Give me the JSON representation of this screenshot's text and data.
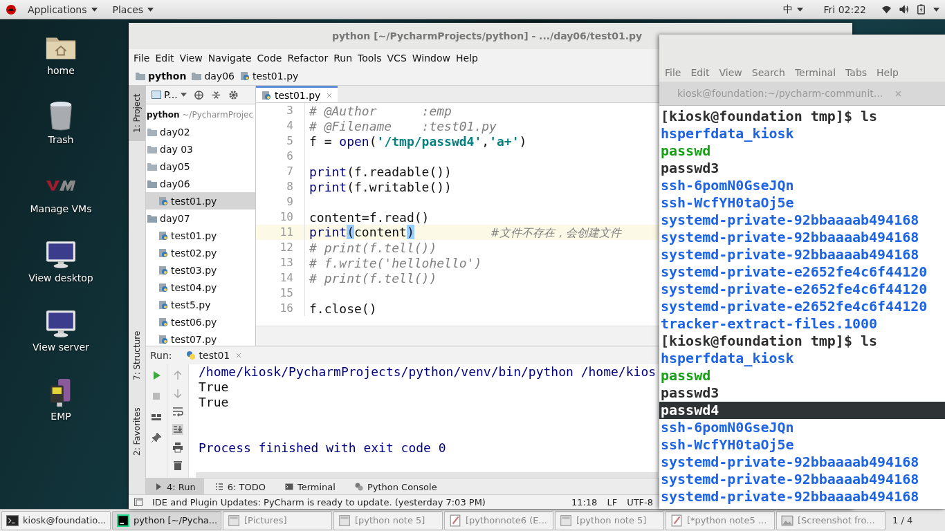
{
  "top_bar": {
    "applications": "Applications",
    "places": "Places",
    "input_method": "中",
    "clock": "Fri 02:22"
  },
  "desktop_icons": [
    {
      "label": "home",
      "kind": "home"
    },
    {
      "label": "Trash",
      "kind": "trash"
    },
    {
      "label": "Manage VMs",
      "kind": "vm"
    },
    {
      "label": "View desktop",
      "kind": "monitor"
    },
    {
      "label": "View server",
      "kind": "monitor"
    },
    {
      "label": "EMP",
      "kind": "emp"
    }
  ],
  "ide": {
    "title": "python [~/PycharmProjects/python] - .../day06/test01.py",
    "menu": [
      "File",
      "Edit",
      "View",
      "Navigate",
      "Code",
      "Refactor",
      "Run",
      "Tools",
      "VCS",
      "Window",
      "Help"
    ],
    "breadcrumb": [
      {
        "label": "python",
        "kind": "project"
      },
      {
        "label": "day06",
        "kind": "folder"
      },
      {
        "label": "test01.py",
        "kind": "file"
      }
    ],
    "side_tabs": [
      {
        "label": "1: Project",
        "selected": true
      },
      {
        "label": "7: Structure",
        "selected": false
      },
      {
        "label": "2: Favorites",
        "selected": false
      }
    ],
    "project_view": "P...",
    "tree_root": {
      "name": "python",
      "path": "~/PycharmProjec"
    },
    "tree": [
      {
        "name": "day02",
        "expanded": false,
        "selected": false
      },
      {
        "name": "day 03",
        "expanded": false,
        "selected": false
      },
      {
        "name": "day05",
        "expanded": false,
        "selected": false
      },
      {
        "name": "day06",
        "expanded": true,
        "selected": false,
        "children": [
          {
            "name": "test01.py",
            "selected": true
          }
        ]
      },
      {
        "name": "day07",
        "expanded": true,
        "selected": false,
        "children": [
          {
            "name": "test01.py",
            "selected": false
          },
          {
            "name": "test02.py",
            "selected": false
          },
          {
            "name": "test03.py",
            "selected": false
          },
          {
            "name": "test04.py",
            "selected": false
          },
          {
            "name": "test5.py",
            "selected": false
          },
          {
            "name": "test06.py",
            "selected": false
          },
          {
            "name": "test07.py",
            "selected": false
          }
        ]
      }
    ],
    "editor_tabs": [
      {
        "label": "test01.py",
        "selected": true
      }
    ],
    "code": [
      {
        "no": "3",
        "current": false,
        "segments": [
          {
            "text": "# @Author      :emp",
            "kind": "comment"
          }
        ]
      },
      {
        "no": "4",
        "current": false,
        "segments": [
          {
            "text": "# @Filename    :test01.py",
            "kind": "comment"
          }
        ]
      },
      {
        "no": "5",
        "current": false,
        "segments": [
          {
            "text": "f = ",
            "kind": "plain"
          },
          {
            "text": "open",
            "kind": "builtin"
          },
          {
            "text": "(",
            "kind": "plain"
          },
          {
            "text": "'/tmp/passwd4'",
            "kind": "string"
          },
          {
            "text": ",",
            "kind": "plain"
          },
          {
            "text": "'a+'",
            "kind": "string"
          },
          {
            "text": ")",
            "kind": "plain"
          }
        ]
      },
      {
        "no": "6",
        "current": false
      },
      {
        "no": "7",
        "current": false,
        "segments": [
          {
            "text": "print",
            "kind": "builtin"
          },
          {
            "text": "(f.readable())",
            "kind": "plain"
          }
        ]
      },
      {
        "no": "8",
        "current": false,
        "segments": [
          {
            "text": "print",
            "kind": "builtin"
          },
          {
            "text": "(f.writable())",
            "kind": "plain"
          }
        ]
      },
      {
        "no": "9",
        "current": false
      },
      {
        "no": "10",
        "current": false,
        "segments": [
          {
            "text": "content=f.read()",
            "kind": "plain"
          }
        ]
      },
      {
        "no": "11",
        "current": true,
        "segments": [
          {
            "text": "print",
            "kind": "builtin"
          },
          {
            "text": "(",
            "kind": "match"
          },
          {
            "text": "content",
            "kind": "plain"
          },
          {
            "text": ")",
            "kind": "match"
          },
          {
            "text": "#文件不存在，会创建文件",
            "kind": "trailing-comment"
          }
        ]
      },
      {
        "no": "12",
        "current": false,
        "segments": [
          {
            "text": "# print(f.tell())",
            "kind": "comment"
          }
        ]
      },
      {
        "no": "13",
        "current": false,
        "segments": [
          {
            "text": "# f.write('hellohello')",
            "kind": "comment"
          }
        ]
      },
      {
        "no": "14",
        "current": false,
        "segments": [
          {
            "text": "# print(f.tell())",
            "kind": "comment"
          }
        ]
      },
      {
        "no": "15",
        "current": false
      },
      {
        "no": "16",
        "current": false,
        "segments": [
          {
            "text": "f.close()",
            "kind": "plain"
          }
        ]
      }
    ],
    "run": {
      "label": "Run:",
      "tab": "test01",
      "output": [
        {
          "text": "/home/kiosk/PycharmProjects/python/venv/bin/python /home/kios",
          "kind": "command"
        },
        {
          "text": "True",
          "kind": "stdout"
        },
        {
          "text": "True",
          "kind": "stdout"
        },
        {
          "text": "Process finished with exit code 0",
          "kind": "exit"
        }
      ]
    },
    "tool_tabs": [
      {
        "label": "4: Run",
        "kind": "run",
        "selected": true
      },
      {
        "label": "6: TODO",
        "kind": "todo",
        "selected": false
      },
      {
        "label": "Terminal",
        "kind": "terminal",
        "selected": false
      },
      {
        "label": "Python Console",
        "kind": "console",
        "selected": false
      }
    ],
    "status": {
      "message": "IDE and Plugin Updates: PyCharm is ready to update. (yesterday 7:03 PM)",
      "position": "11:18",
      "line_ending": "LF",
      "encoding": "UTF-8"
    }
  },
  "terminal": {
    "menu": [
      "File",
      "Edit",
      "View",
      "Search",
      "Terminal",
      "Tabs",
      "Help"
    ],
    "tab": "kiosk@foundation:~/pycharm-communit...",
    "lines": [
      {
        "text": "[kiosk@foundation tmp]$ ls",
        "kind": "prompt",
        "highlighted": false
      },
      {
        "text": "hsperfdata_kiosk",
        "kind": "dir",
        "highlighted": false
      },
      {
        "text": "passwd",
        "kind": "exec",
        "highlighted": false
      },
      {
        "text": "passwd3",
        "kind": "file",
        "highlighted": false
      },
      {
        "text": "ssh-6pomN0GseJQn",
        "kind": "dir",
        "highlighted": false
      },
      {
        "text": "ssh-WcfYH0taOj5e",
        "kind": "dir",
        "highlighted": false
      },
      {
        "text": "systemd-private-92bbaaaab494168",
        "kind": "dir",
        "highlighted": false
      },
      {
        "text": "systemd-private-92bbaaaab494168",
        "kind": "dir",
        "highlighted": false
      },
      {
        "text": "systemd-private-92bbaaaab494168",
        "kind": "dir",
        "highlighted": false
      },
      {
        "text": "systemd-private-e2652fe4c6f44120",
        "kind": "dir",
        "highlighted": false
      },
      {
        "text": "systemd-private-e2652fe4c6f44120",
        "kind": "dir",
        "highlighted": false
      },
      {
        "text": "systemd-private-e2652fe4c6f44120",
        "kind": "dir",
        "highlighted": false
      },
      {
        "text": "tracker-extract-files.1000",
        "kind": "dir",
        "highlighted": false
      },
      {
        "text": "[kiosk@foundation tmp]$ ls",
        "kind": "prompt",
        "highlighted": false
      },
      {
        "text": "hsperfdata_kiosk",
        "kind": "dir",
        "highlighted": false
      },
      {
        "text": "passwd",
        "kind": "exec",
        "highlighted": false
      },
      {
        "text": "passwd3",
        "kind": "file",
        "highlighted": false
      },
      {
        "text": "passwd4",
        "kind": "file",
        "highlighted": true
      },
      {
        "text": "ssh-6pomN0GseJQn",
        "kind": "dir",
        "highlighted": false
      },
      {
        "text": "ssh-WcfYH0taOj5e",
        "kind": "dir",
        "highlighted": false
      },
      {
        "text": "systemd-private-92bbaaaab494168",
        "kind": "dir",
        "highlighted": false
      },
      {
        "text": "systemd-private-92bbaaaab494168",
        "kind": "dir",
        "highlighted": false
      },
      {
        "text": "systemd-private-92bbaaaab494168",
        "kind": "dir",
        "highlighted": false
      }
    ]
  },
  "taskbar": {
    "items": [
      {
        "label": "kiosk@foundatio...",
        "kind": "terminal",
        "selected": false
      },
      {
        "label": "python [~/Pycha...",
        "kind": "pycharm",
        "selected": true
      },
      {
        "label": "[Pictures]",
        "kind": "window",
        "selected": false
      },
      {
        "label": "[python note 5]",
        "kind": "window",
        "selected": false
      },
      {
        "label": "[pythonnote6 (E...",
        "kind": "editor",
        "selected": false
      },
      {
        "label": "[python note 5]",
        "kind": "window",
        "selected": false
      },
      {
        "label": "[*python note5 ...",
        "kind": "editor",
        "selected": false
      },
      {
        "label": "[Screenshot fro...",
        "kind": "image",
        "selected": false
      }
    ],
    "pager": "1 / 4"
  }
}
